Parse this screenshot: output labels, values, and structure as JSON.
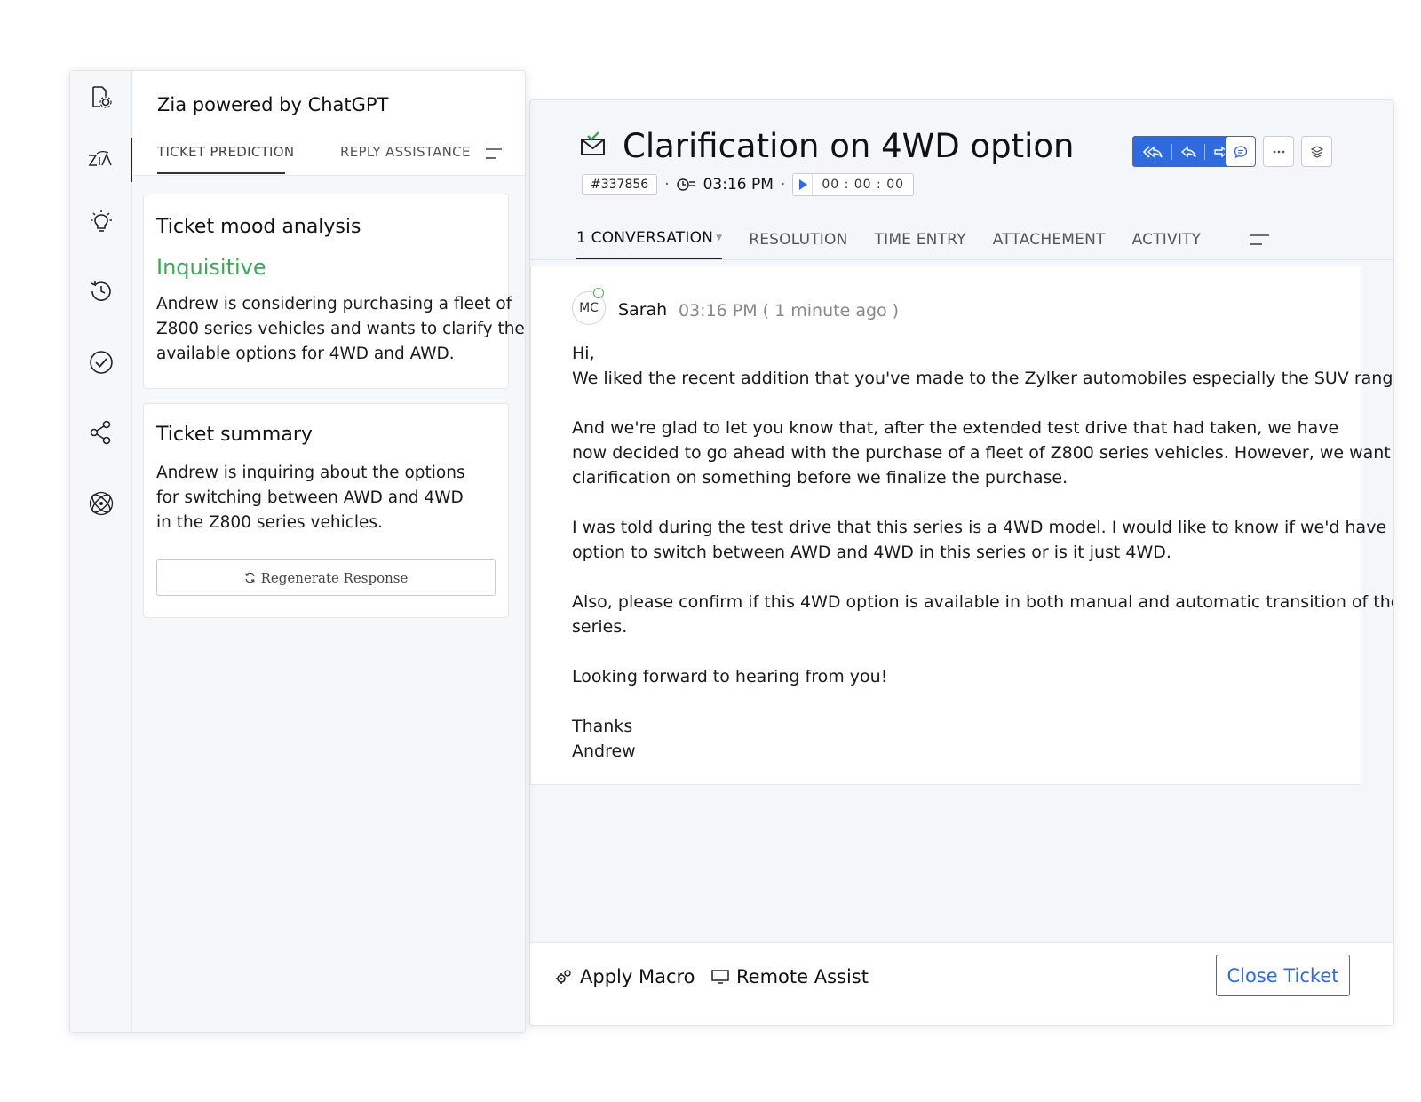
{
  "ticket": {
    "title": "Clarification on 4WD option",
    "id": "#337856",
    "time": "03:16 PM",
    "timer": "00 : 00 : 00",
    "tabs": {
      "conversation": "1 CONVERSATION",
      "resolution": "RESOLUTION",
      "time_entry": "TIME ENTRY",
      "attachment": "ATTACHEMENT",
      "activity": "ACTIVITY"
    },
    "message": {
      "avatar": "MC",
      "sender": "Sarah",
      "time": "03:16 PM ( 1 minute ago )",
      "body": "Hi,\nWe liked the recent addition that you've made to the Zylker automobiles especially the SUV range.\n\nAnd we're glad to let you know that, after the extended test drive that had taken, we have\nnow decided to go ahead with the purchase of a fleet of Z800 series vehicles. However, we want\nclarification on something before we finalize the purchase.\n\nI was told during the test drive that this series is a 4WD model. I would like to know if we'd have an\noption to switch between AWD and 4WD in this series or is it just 4WD.\n\nAlso, please confirm if this 4WD option is available in both manual and automatic transition of the\nseries.\n\nLooking forward to hearing from you!\n\nThanks\nAndrew"
    },
    "footer": {
      "apply_macro": "Apply Macro",
      "remote_assist": "Remote Assist",
      "close_ticket": "Close Ticket"
    }
  },
  "zia": {
    "title": "Zia powered by ChatGPT",
    "tabs": {
      "prediction": "TICKET PREDICTION",
      "reply": "REPLY ASSISTANCE"
    },
    "mood_card": {
      "title": "Ticket mood analysis",
      "mood": "Inquisitive",
      "text": "Andrew is considering purchasing a fleet of\nZ800 series vehicles and wants to clarify the\navailable options for 4WD and AWD."
    },
    "summary_card": {
      "title": "Ticket summary",
      "text": "Andrew is inquiring about the options\nfor switching between AWD and 4WD\nin the Z800 series vehicles.",
      "regenerate": "Regenerate Response"
    },
    "rail_icons": [
      "settings-doc-icon",
      "zia-icon",
      "bulb-icon",
      "history-icon",
      "check-circle-icon",
      "share-icon",
      "atom-icon"
    ]
  },
  "colors": {
    "accent": "#2f6bdf",
    "mood": "#3aa856"
  }
}
